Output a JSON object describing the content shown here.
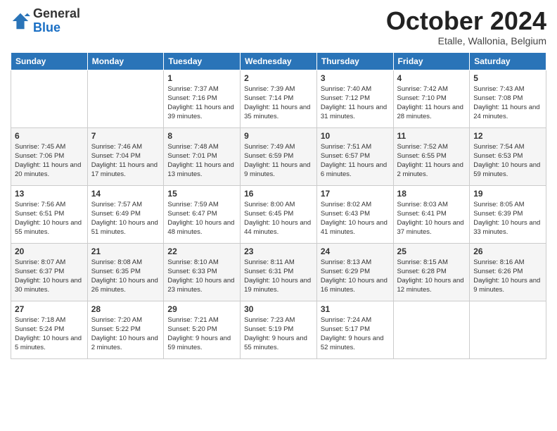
{
  "logo": {
    "general": "General",
    "blue": "Blue"
  },
  "header": {
    "month": "October 2024",
    "location": "Etalle, Wallonia, Belgium"
  },
  "days_of_week": [
    "Sunday",
    "Monday",
    "Tuesday",
    "Wednesday",
    "Thursday",
    "Friday",
    "Saturday"
  ],
  "weeks": [
    [
      null,
      null,
      {
        "day": 1,
        "sunrise": "7:37 AM",
        "sunset": "7:16 PM",
        "daylight": "11 hours and 39 minutes."
      },
      {
        "day": 2,
        "sunrise": "7:39 AM",
        "sunset": "7:14 PM",
        "daylight": "11 hours and 35 minutes."
      },
      {
        "day": 3,
        "sunrise": "7:40 AM",
        "sunset": "7:12 PM",
        "daylight": "11 hours and 31 minutes."
      },
      {
        "day": 4,
        "sunrise": "7:42 AM",
        "sunset": "7:10 PM",
        "daylight": "11 hours and 28 minutes."
      },
      {
        "day": 5,
        "sunrise": "7:43 AM",
        "sunset": "7:08 PM",
        "daylight": "11 hours and 24 minutes."
      }
    ],
    [
      {
        "day": 6,
        "sunrise": "7:45 AM",
        "sunset": "7:06 PM",
        "daylight": "11 hours and 20 minutes."
      },
      {
        "day": 7,
        "sunrise": "7:46 AM",
        "sunset": "7:04 PM",
        "daylight": "11 hours and 17 minutes."
      },
      {
        "day": 8,
        "sunrise": "7:48 AM",
        "sunset": "7:01 PM",
        "daylight": "11 hours and 13 minutes."
      },
      {
        "day": 9,
        "sunrise": "7:49 AM",
        "sunset": "6:59 PM",
        "daylight": "11 hours and 9 minutes."
      },
      {
        "day": 10,
        "sunrise": "7:51 AM",
        "sunset": "6:57 PM",
        "daylight": "11 hours and 6 minutes."
      },
      {
        "day": 11,
        "sunrise": "7:52 AM",
        "sunset": "6:55 PM",
        "daylight": "11 hours and 2 minutes."
      },
      {
        "day": 12,
        "sunrise": "7:54 AM",
        "sunset": "6:53 PM",
        "daylight": "10 hours and 59 minutes."
      }
    ],
    [
      {
        "day": 13,
        "sunrise": "7:56 AM",
        "sunset": "6:51 PM",
        "daylight": "10 hours and 55 minutes."
      },
      {
        "day": 14,
        "sunrise": "7:57 AM",
        "sunset": "6:49 PM",
        "daylight": "10 hours and 51 minutes."
      },
      {
        "day": 15,
        "sunrise": "7:59 AM",
        "sunset": "6:47 PM",
        "daylight": "10 hours and 48 minutes."
      },
      {
        "day": 16,
        "sunrise": "8:00 AM",
        "sunset": "6:45 PM",
        "daylight": "10 hours and 44 minutes."
      },
      {
        "day": 17,
        "sunrise": "8:02 AM",
        "sunset": "6:43 PM",
        "daylight": "10 hours and 41 minutes."
      },
      {
        "day": 18,
        "sunrise": "8:03 AM",
        "sunset": "6:41 PM",
        "daylight": "10 hours and 37 minutes."
      },
      {
        "day": 19,
        "sunrise": "8:05 AM",
        "sunset": "6:39 PM",
        "daylight": "10 hours and 33 minutes."
      }
    ],
    [
      {
        "day": 20,
        "sunrise": "8:07 AM",
        "sunset": "6:37 PM",
        "daylight": "10 hours and 30 minutes."
      },
      {
        "day": 21,
        "sunrise": "8:08 AM",
        "sunset": "6:35 PM",
        "daylight": "10 hours and 26 minutes."
      },
      {
        "day": 22,
        "sunrise": "8:10 AM",
        "sunset": "6:33 PM",
        "daylight": "10 hours and 23 minutes."
      },
      {
        "day": 23,
        "sunrise": "8:11 AM",
        "sunset": "6:31 PM",
        "daylight": "10 hours and 19 minutes."
      },
      {
        "day": 24,
        "sunrise": "8:13 AM",
        "sunset": "6:29 PM",
        "daylight": "10 hours and 16 minutes."
      },
      {
        "day": 25,
        "sunrise": "8:15 AM",
        "sunset": "6:28 PM",
        "daylight": "10 hours and 12 minutes."
      },
      {
        "day": 26,
        "sunrise": "8:16 AM",
        "sunset": "6:26 PM",
        "daylight": "10 hours and 9 minutes."
      }
    ],
    [
      {
        "day": 27,
        "sunrise": "7:18 AM",
        "sunset": "5:24 PM",
        "daylight": "10 hours and 5 minutes."
      },
      {
        "day": 28,
        "sunrise": "7:20 AM",
        "sunset": "5:22 PM",
        "daylight": "10 hours and 2 minutes."
      },
      {
        "day": 29,
        "sunrise": "7:21 AM",
        "sunset": "5:20 PM",
        "daylight": "9 hours and 59 minutes."
      },
      {
        "day": 30,
        "sunrise": "7:23 AM",
        "sunset": "5:19 PM",
        "daylight": "9 hours and 55 minutes."
      },
      {
        "day": 31,
        "sunrise": "7:24 AM",
        "sunset": "5:17 PM",
        "daylight": "9 hours and 52 minutes."
      },
      null,
      null
    ]
  ]
}
